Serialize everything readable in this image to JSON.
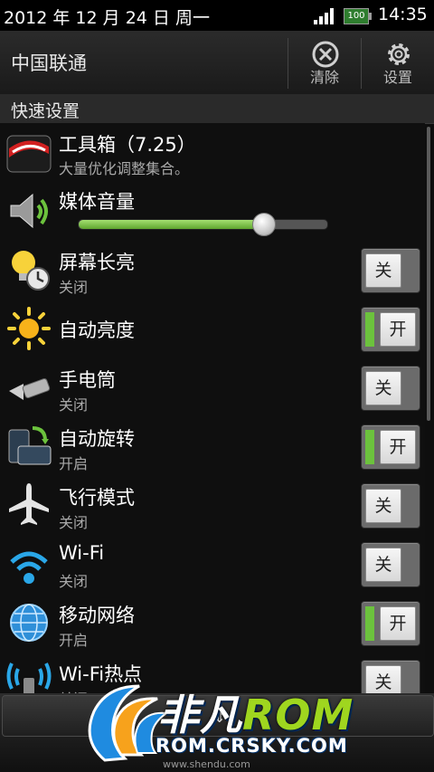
{
  "status_bar": {
    "date": "2012 年 12 月 24 日 周一",
    "battery": "100",
    "time": "14:35",
    "signal_icon": "signal-bars-icon"
  },
  "header": {
    "carrier": "中国联通",
    "clear_label": "清除",
    "settings_label": "设置"
  },
  "section": {
    "title": "快速设置"
  },
  "items": [
    {
      "title": "工具箱（7.25）",
      "subtitle": "大量优化调整集合。",
      "icon": "toolbox-icon"
    },
    {
      "title": "媒体音量",
      "icon": "speaker-icon",
      "volume": 0.74
    },
    {
      "title": "屏幕长亮",
      "subtitle": "关闭",
      "toggle": "关",
      "state": "off",
      "icon": "lightbulb-clock-icon"
    },
    {
      "title": "自动亮度",
      "toggle": "开",
      "state": "on",
      "icon": "sun-icon"
    },
    {
      "title": "手电筒",
      "subtitle": "关闭",
      "toggle": "关",
      "state": "off",
      "icon": "flashlight-icon"
    },
    {
      "title": "自动旋转",
      "subtitle": "开启",
      "toggle": "开",
      "state": "on",
      "icon": "rotate-screen-icon"
    },
    {
      "title": "飞行模式",
      "subtitle": "关闭",
      "toggle": "关",
      "state": "off",
      "icon": "airplane-icon"
    },
    {
      "title": "Wi-Fi",
      "subtitle": "关闭",
      "toggle": "关",
      "state": "off",
      "icon": "wifi-icon"
    },
    {
      "title": "移动网络",
      "subtitle": "开启",
      "toggle": "开",
      "state": "on",
      "icon": "globe-icon"
    },
    {
      "title": "Wi-Fi热点",
      "subtitle": "关闭",
      "toggle": "关",
      "state": "off",
      "icon": "wifi-hotspot-icon"
    }
  ],
  "watermark": {
    "name": "非凡",
    "rom": "ROM",
    "url": "ROM.CRSKY.COM",
    "site": "www.shendu.com"
  },
  "colors": {
    "toggle_on": "#6cc23d",
    "slider_fill": "#8fd05a"
  }
}
